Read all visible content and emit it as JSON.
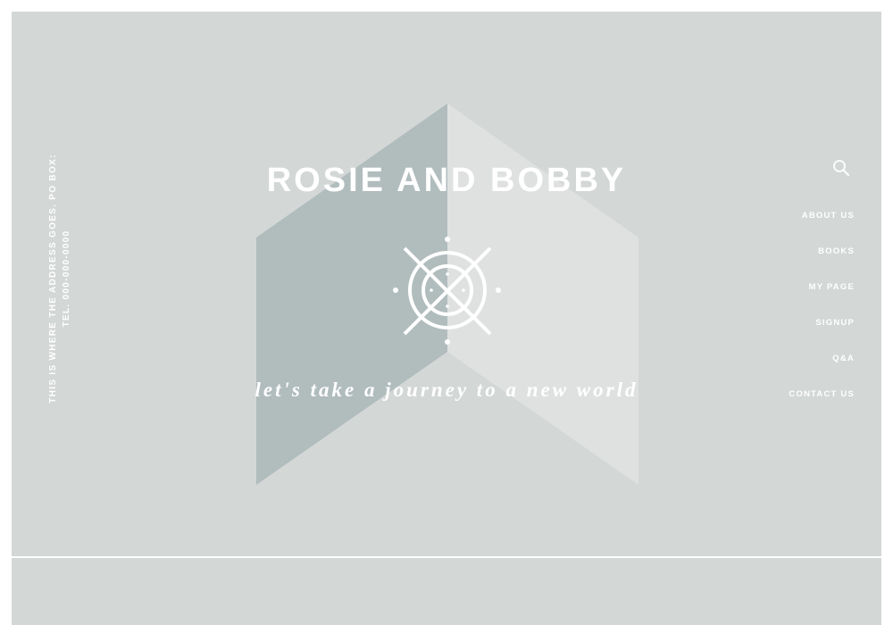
{
  "site": {
    "title": "ROSIE AND BOBBY",
    "tagline": "let's take a journey to a new world"
  },
  "address": {
    "line1": "THIS IS WHERE THE ADDRESS GOES. PO BOX:",
    "line2": "TEL. 000-000-0000"
  },
  "nav": {
    "items": [
      {
        "label": "ABOUT US"
      },
      {
        "label": "BOOKS"
      },
      {
        "label": "MY PAGE"
      },
      {
        "label": "SIGNUP"
      },
      {
        "label": "Q&A"
      },
      {
        "label": "CONTACT US"
      }
    ]
  },
  "icons": {
    "search": "search-icon",
    "logo": "crossed-compass-logo-icon"
  },
  "colors": {
    "background": "#d3d7d6",
    "panel_dark": "#b1bcbd",
    "panel_light": "#dfe1e0",
    "text": "#ffffff"
  }
}
